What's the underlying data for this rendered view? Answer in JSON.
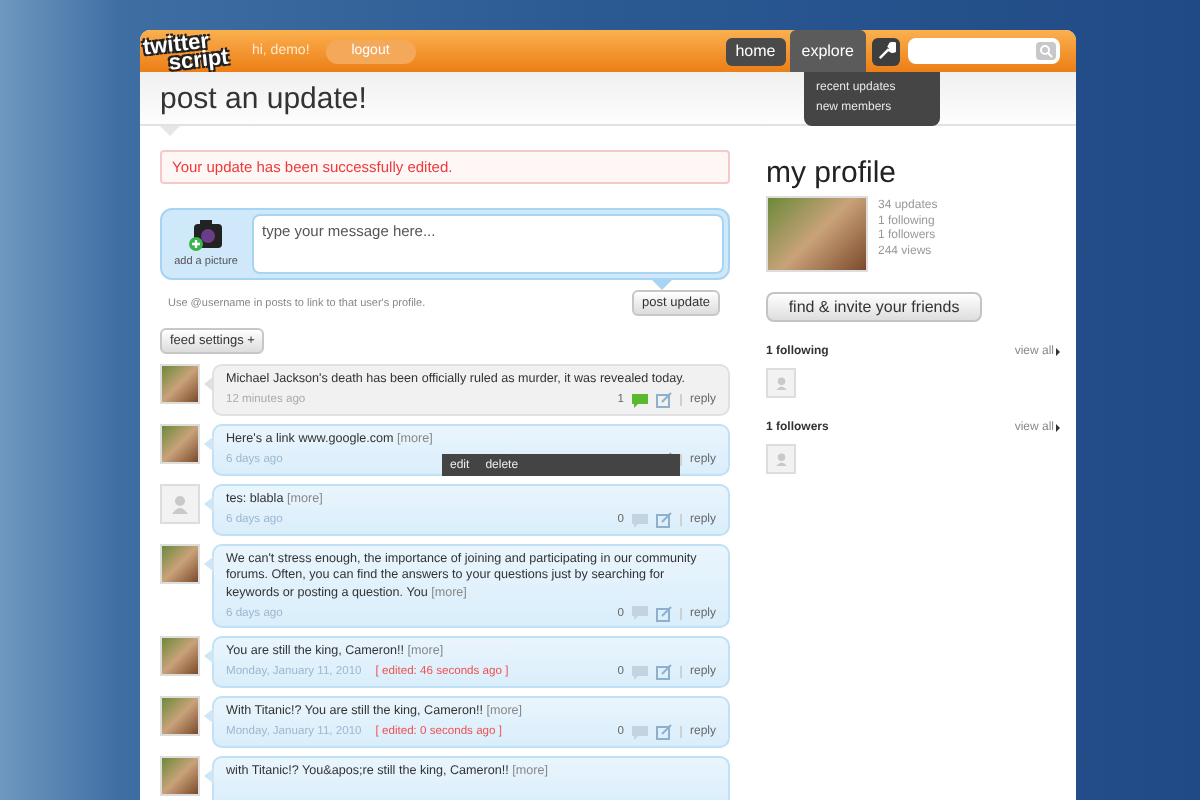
{
  "header": {
    "logo_lines": [
      "twitter",
      "script"
    ],
    "greeting": "hi, demo!",
    "logout": "logout",
    "nav": [
      {
        "label": "home",
        "selected": false
      },
      {
        "label": "explore",
        "selected": true
      }
    ],
    "explore_menu": [
      "recent updates",
      "new members"
    ]
  },
  "page_title": "post an update!",
  "alert": "Your update has been successfully edited.",
  "composer": {
    "picture_caption": "add a picture",
    "placeholder": "type your message here...",
    "hint": "Use @username in posts to link to that user's profile.",
    "button": "post update"
  },
  "feed_settings": "feed settings +",
  "feed": [
    {
      "has_photo": true,
      "highlighted": false,
      "text": "Michael Jackson's death has been officially ruled as murder, it was revealed today.",
      "time": "12 minutes ago",
      "comments": "1",
      "commented": true,
      "reply": "reply"
    },
    {
      "has_photo": true,
      "highlighted": true,
      "text": "Here's a link www.google.com",
      "more": "[more]",
      "time": "6 days ago",
      "menu": [
        "edit",
        "delete"
      ],
      "reply": "reply"
    },
    {
      "has_photo": false,
      "highlighted": true,
      "text": "tes: blabla",
      "more": "[more]",
      "time": "6 days ago",
      "comments": "0",
      "commented": false,
      "reply": "reply"
    },
    {
      "has_photo": true,
      "highlighted": true,
      "text": "We can't stress enough, the importance of joining and participating in our community forums. Often, you can find the answers to your questions just by searching for keywords or posting a question. You",
      "more": "[more]",
      "time": "6 days ago",
      "comments": "0",
      "commented": false,
      "reply": "reply"
    },
    {
      "has_photo": true,
      "highlighted": true,
      "text": "You are still the king, Cameron!!",
      "more": "[more]",
      "time": "Monday, January 11, 2010",
      "edited": "[ edited: 46 seconds ago ]",
      "comments": "0",
      "commented": false,
      "reply": "reply"
    },
    {
      "has_photo": true,
      "highlighted": true,
      "text": "With Titanic!? You are still the king, Cameron!!",
      "more": "[more]",
      "time": "Monday, January 11, 2010",
      "edited": "[ edited: 0 seconds ago ]",
      "comments": "0",
      "commented": false,
      "reply": "reply"
    },
    {
      "has_photo": true,
      "highlighted": true,
      "text": "with Titanic!? You&apos;re still the king, Cameron!!",
      "more": "[more]"
    }
  ],
  "profile": {
    "title": "my profile",
    "stats": [
      "34 updates",
      "1 following",
      "1 followers",
      "244 views"
    ],
    "invite_button": "find & invite your friends",
    "sections": [
      {
        "title": "1 following",
        "link": "view all",
        "avatars": [
          {
            "has_photo": false
          }
        ]
      },
      {
        "title": "1 followers",
        "link": "view all",
        "avatars": [
          {
            "has_photo": false
          }
        ]
      }
    ]
  }
}
